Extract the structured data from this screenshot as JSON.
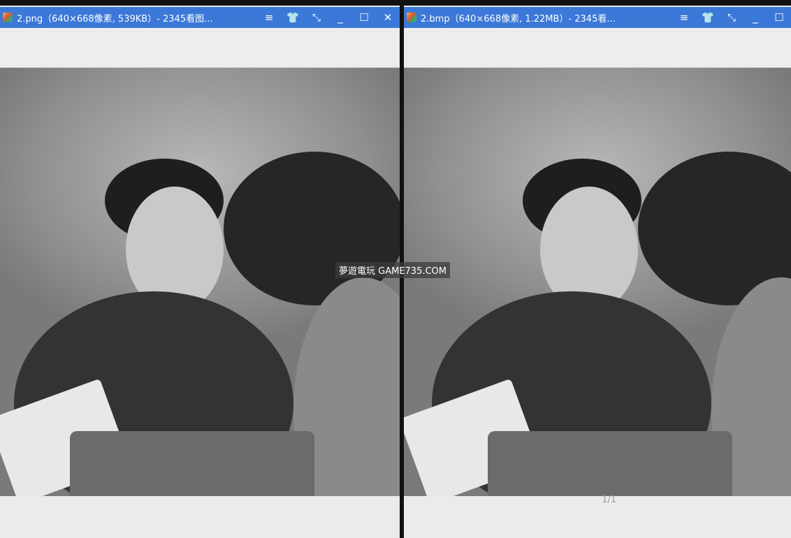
{
  "windows": [
    {
      "title": "2.png（640×668像素, 539KB）- 2345看图...",
      "controls": [
        "≡",
        "👕",
        "⤡",
        "_",
        "☐",
        "✕"
      ]
    },
    {
      "title": "2.bmp（640×668像素, 1.22MB）- 2345看...",
      "controls": [
        "≡",
        "👕",
        "⤡",
        "_",
        "☐"
      ],
      "page_indicator": "1/1"
    }
  ],
  "watermark": "夢遊電玩 GAME735.COM"
}
